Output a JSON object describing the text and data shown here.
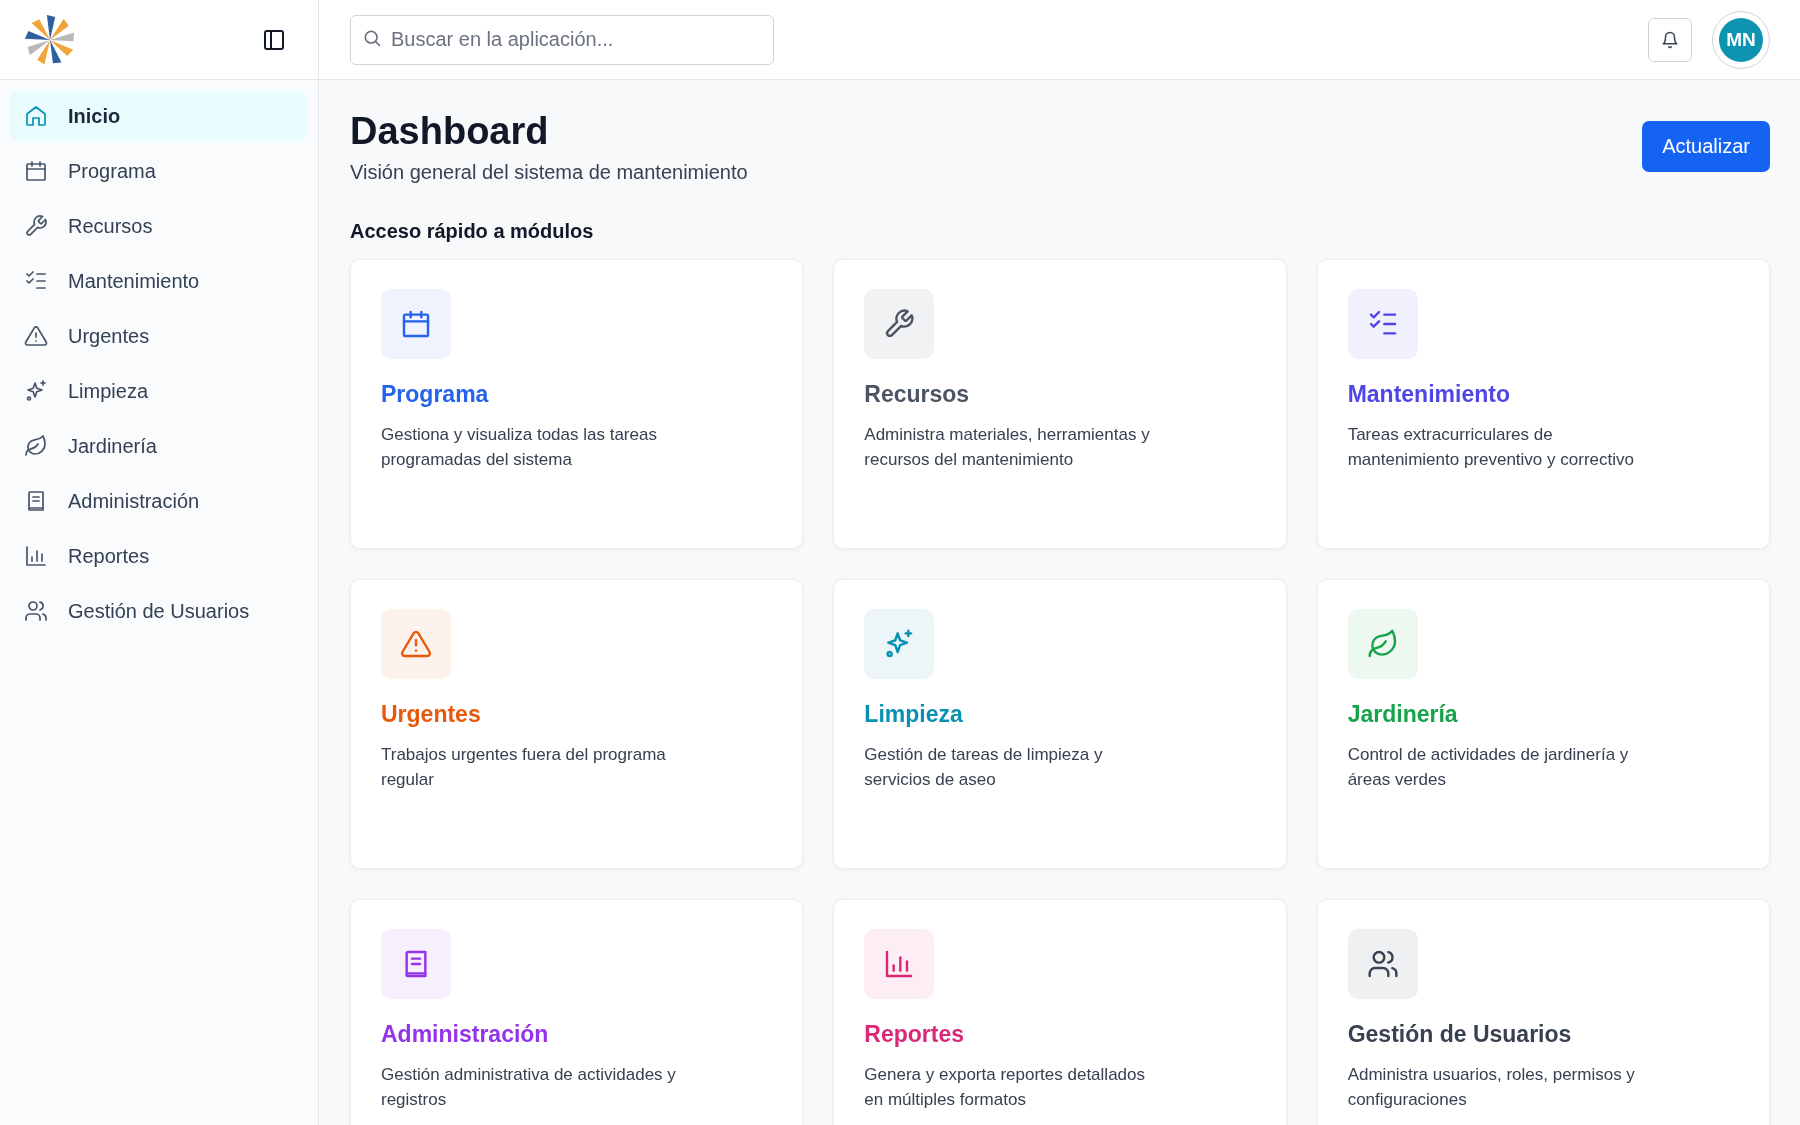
{
  "sidebar": {
    "items": [
      {
        "label": "Inicio",
        "selected": true
      },
      {
        "label": "Programa",
        "selected": false
      },
      {
        "label": "Recursos",
        "selected": false
      },
      {
        "label": "Mantenimiento",
        "selected": false
      },
      {
        "label": "Urgentes",
        "selected": false
      },
      {
        "label": "Limpieza",
        "selected": false
      },
      {
        "label": "Jardinería",
        "selected": false
      },
      {
        "label": "Administración",
        "selected": false
      },
      {
        "label": "Reportes",
        "selected": false
      },
      {
        "label": "Gestión de Usuarios",
        "selected": false
      }
    ]
  },
  "header": {
    "search": {
      "placeholder": "Buscar en la aplicación..."
    },
    "avatar": "MN"
  },
  "page": {
    "title": "Dashboard",
    "subtitle": "Visión general del sistema de mantenimiento",
    "action": "Actualizar",
    "section_title": "Acceso rápido a módulos"
  },
  "modules": [
    {
      "title": "Programa",
      "description": "Gestiona y visualiza todas las tareas programadas del sistema",
      "color": "#2563eb"
    },
    {
      "title": "Recursos",
      "description": "Administra materiales, herramientas y recursos del mantenimiento",
      "color": "#4b5563"
    },
    {
      "title": "Mantenimiento",
      "description": "Tareas extracurriculares de mantenimiento preventivo y correctivo",
      "color": "#4f46e5"
    },
    {
      "title": "Urgentes",
      "description": "Trabajos urgentes fuera del programa regular",
      "color": "#ea580c"
    },
    {
      "title": "Limpieza",
      "description": "Gestión de tareas de limpieza y servicios de aseo",
      "color": "#0891b2"
    },
    {
      "title": "Jardinería",
      "description": "Control de actividades de jardinería y áreas verdes",
      "color": "#16a34a"
    },
    {
      "title": "Administración",
      "description": "Gestión administrativa de actividades y registros",
      "color": "#9333ea"
    },
    {
      "title": "Reportes",
      "description": "Genera y exporta reportes detallados en múltiples formatos",
      "color": "#db2777"
    },
    {
      "title": "Gestión de Usuarios",
      "description": "Administra usuarios, roles, permisos y configuraciones",
      "color": "#374151"
    }
  ]
}
